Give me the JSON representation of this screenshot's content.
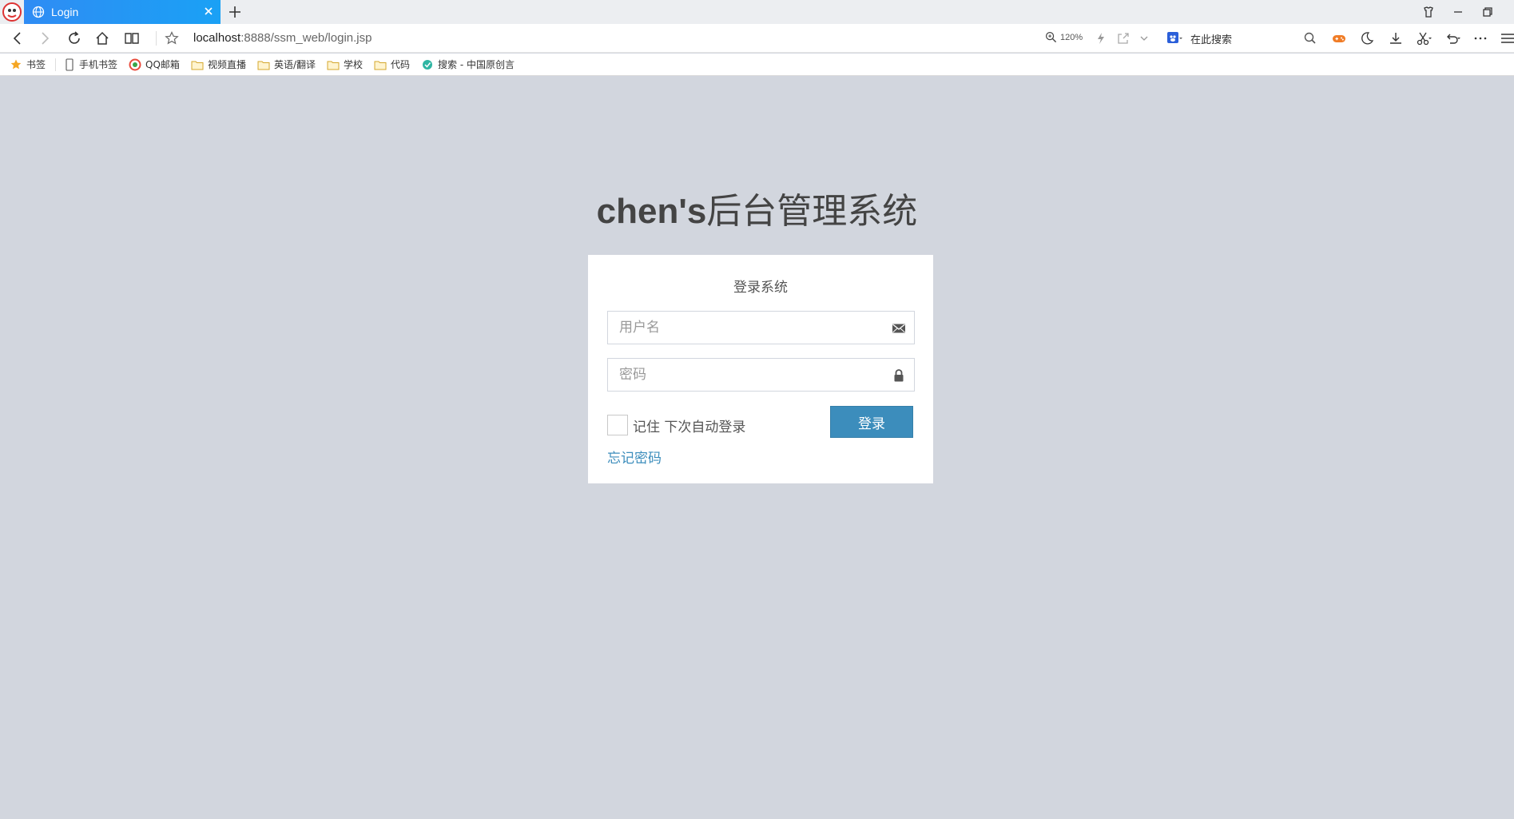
{
  "browser": {
    "tab_title": "Login",
    "url_host": "localhost",
    "url_path": ":8888/ssm_web/login.jsp",
    "zoom": "120%",
    "search_engine_label": "在此搜索",
    "accent_color": "#1e96f5"
  },
  "bookmarks": {
    "items": [
      {
        "label": "书签",
        "icon": "star-icon"
      },
      {
        "label": "手机书签",
        "icon": "phone-icon"
      },
      {
        "label": "QQ邮箱",
        "icon": "qq-mail-icon"
      },
      {
        "label": "视频直播",
        "icon": "folder-icon"
      },
      {
        "label": "英语/翻译",
        "icon": "folder-icon"
      },
      {
        "label": "学校",
        "icon": "folder-icon"
      },
      {
        "label": "代码",
        "icon": "folder-icon"
      },
      {
        "label": "搜索 - 中国原创言",
        "icon": "site-icon"
      }
    ]
  },
  "login": {
    "logo_bold": "chen's",
    "logo_rest": "后台管理系统",
    "box_message": "登录系统",
    "username_placeholder": "用户名",
    "password_placeholder": "密码",
    "remember_label": "记住 下次自动登录",
    "submit_label": "登录",
    "forgot_label": "忘记密码",
    "primary_color": "#3c8dbc",
    "background_color": "#d2d6de"
  }
}
